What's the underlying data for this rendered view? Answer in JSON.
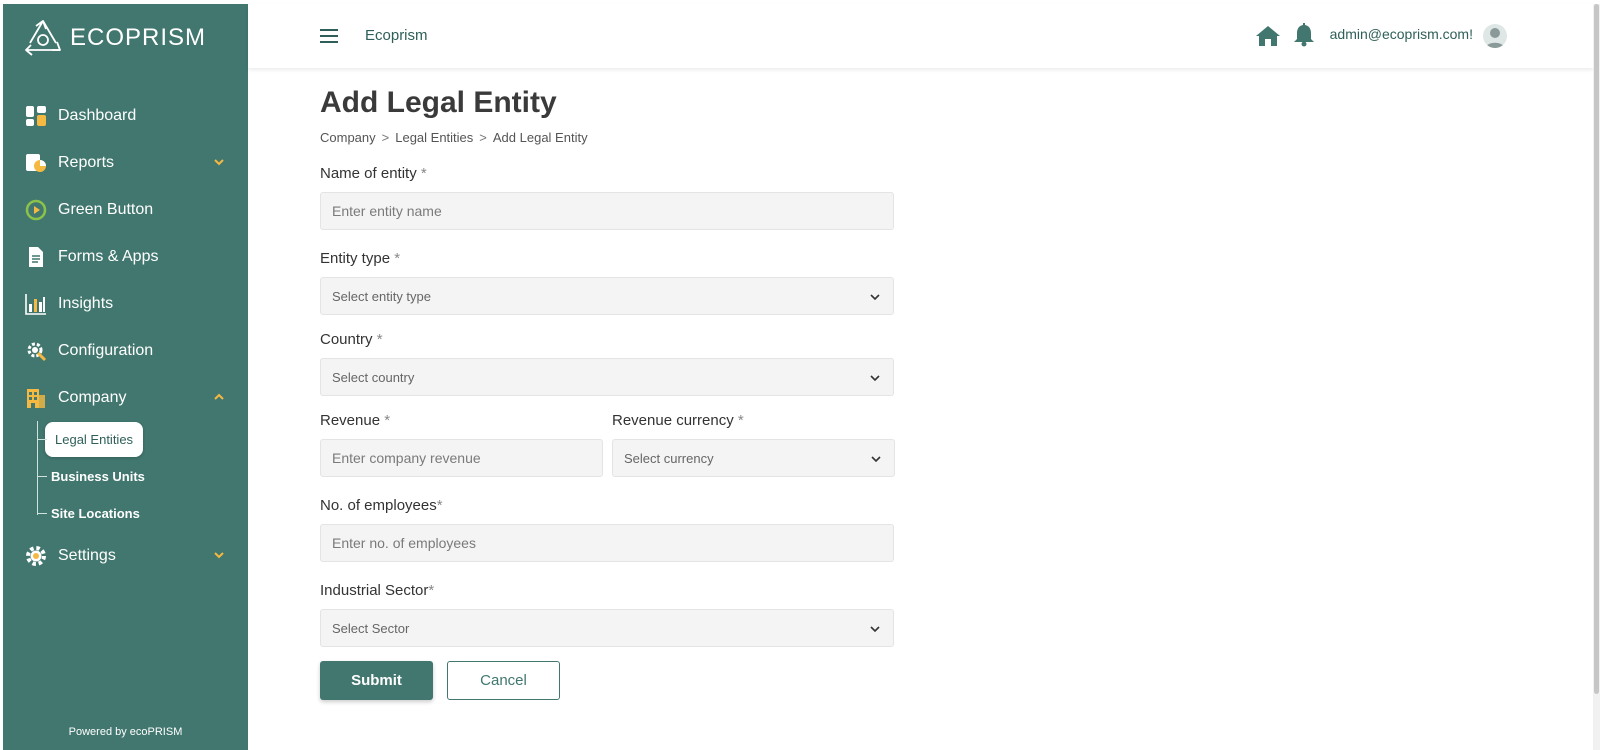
{
  "app": {
    "logo_text": "ECOPRISM",
    "brand": "Ecoprism",
    "powered": "Powered by ecoPRISM"
  },
  "colors": {
    "sidebar": "#41776f",
    "accent": "#41776f",
    "icon_yellow": "#f5b941",
    "icon_green": "#8bc34a"
  },
  "topbar": {
    "user_email": "admin@ecoprism.com!"
  },
  "sidebar": {
    "items": [
      {
        "label": "Dashboard",
        "icon": "dashboard-icon"
      },
      {
        "label": "Reports",
        "icon": "reports-icon",
        "expandable": true
      },
      {
        "label": "Green Button",
        "icon": "play-icon"
      },
      {
        "label": "Forms & Apps",
        "icon": "document-icon"
      },
      {
        "label": "Insights",
        "icon": "bar-chart-icon"
      },
      {
        "label": "Configuration",
        "icon": "configuration-icon"
      },
      {
        "label": "Company",
        "icon": "building-icon",
        "expandable": true,
        "expanded": true
      },
      {
        "label": "Settings",
        "icon": "gear-icon",
        "expandable": true
      }
    ],
    "company_sub": [
      {
        "label": "Legal Entities",
        "active": true
      },
      {
        "label": "Business Units"
      },
      {
        "label": "Site Locations"
      }
    ]
  },
  "page": {
    "title": "Add Legal Entity",
    "breadcrumb": [
      "Company",
      "Legal Entities",
      "Add Legal Entity"
    ],
    "breadcrumb_sep": ">"
  },
  "form": {
    "name": {
      "label": "Name of entity",
      "req": " *",
      "placeholder": "Enter entity name"
    },
    "entity_type": {
      "label": "Entity type",
      "req": " *",
      "placeholder": "Select entity type"
    },
    "country": {
      "label": "Country",
      "req": " *",
      "placeholder": "Select country"
    },
    "revenue": {
      "label": "Revenue",
      "req": " *",
      "placeholder": "Enter company revenue"
    },
    "currency": {
      "label": "Revenue currency",
      "req": " *",
      "placeholder": "Select currency"
    },
    "employees": {
      "label": "No. of employees",
      "req": "*",
      "placeholder": "Enter no. of employees"
    },
    "sector": {
      "label": "Industrial Sector",
      "req": "*",
      "placeholder": "Select Sector"
    },
    "submit": "Submit",
    "cancel": "Cancel"
  }
}
